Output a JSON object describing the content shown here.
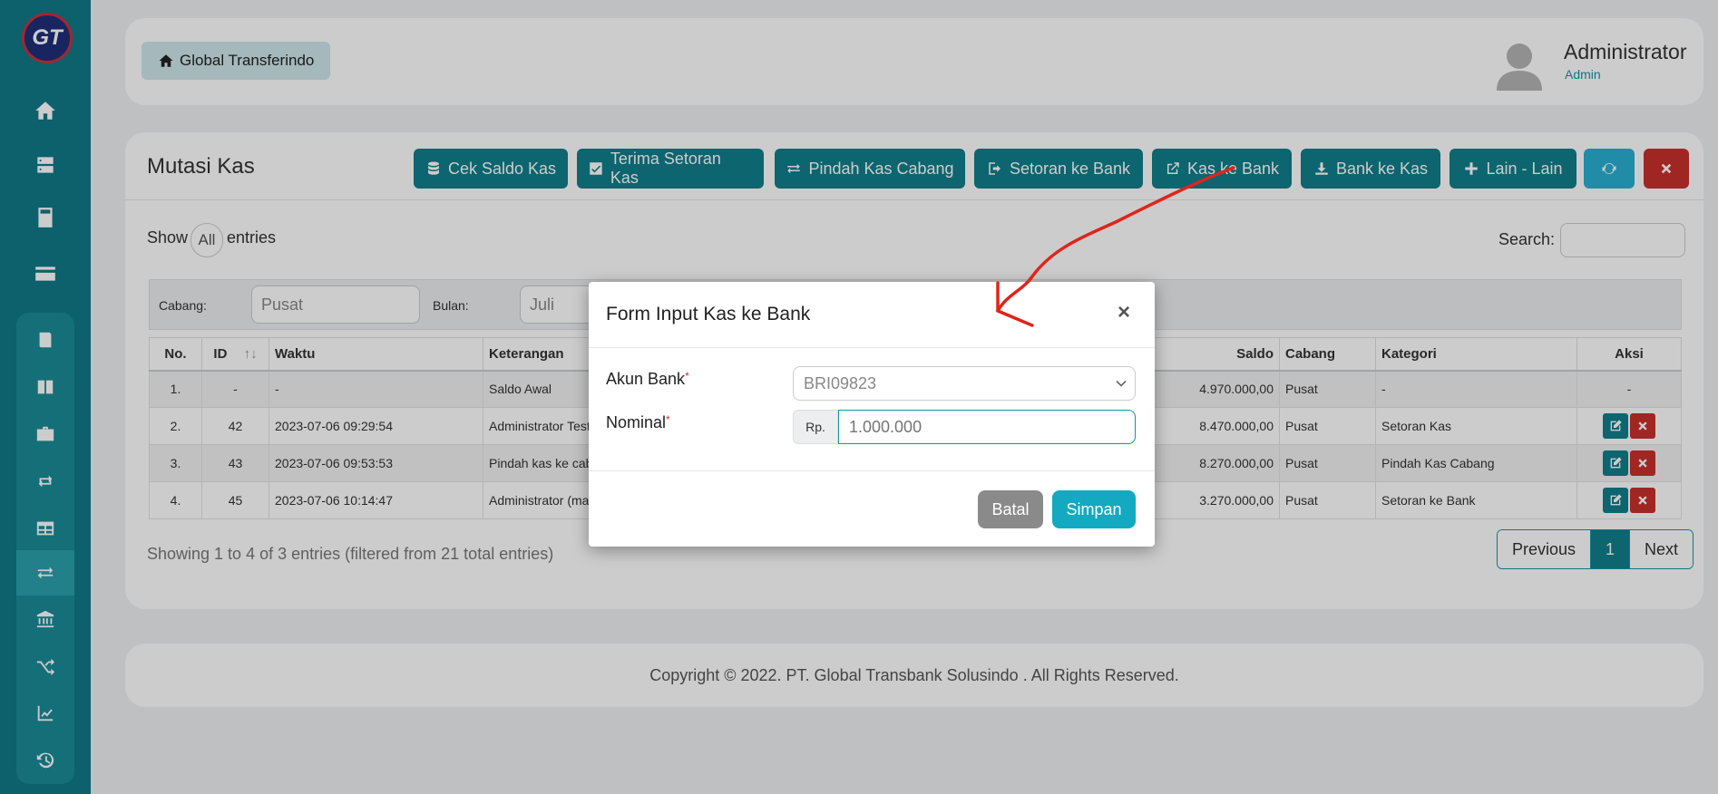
{
  "app": {
    "logo_text": "GT"
  },
  "sidebar": {
    "top_icons": [
      "home-icon",
      "server-icon",
      "calculator-icon",
      "card-icon"
    ],
    "sub_icons": [
      "book-icon",
      "columns-icon",
      "briefcase-icon",
      "retweet-icon",
      "table-icon",
      "exchange-icon",
      "bank-icon",
      "shuffle-icon",
      "chart-icon",
      "history-icon"
    ]
  },
  "header": {
    "brand": "Global Transferindo",
    "user_name": "Administrator",
    "user_role": "Admin"
  },
  "page": {
    "title": "Mutasi Kas",
    "buttons": [
      {
        "label": "Cek Saldo Kas",
        "icon": "database-icon"
      },
      {
        "label": "Terima Setoran Kas",
        "icon": "check-square-icon"
      },
      {
        "label": "Pindah Kas Cabang",
        "icon": "exchange-icon"
      },
      {
        "label": "Setoran ke Bank",
        "icon": "sign-out-icon"
      },
      {
        "label": "Kas ke Bank",
        "icon": "external-link-icon"
      },
      {
        "label": "Bank ke Kas",
        "icon": "download-icon"
      },
      {
        "label": "Lain - Lain",
        "icon": "plus-icon"
      }
    ],
    "refresh_icon": "refresh-icon",
    "close_icon": "close-icon"
  },
  "table_controls": {
    "show_label": "Show",
    "show_value": "All",
    "entries_label": "entries",
    "search_label": "Search:"
  },
  "filters": {
    "cabang_label": "Cabang:",
    "cabang_value": "Pusat",
    "bulan_label": "Bulan:",
    "bulan_value": "Juli"
  },
  "table": {
    "headers": [
      "No.",
      "ID",
      "Waktu",
      "Keterangan",
      "Saldo",
      "Cabang",
      "Kategori",
      "Aksi"
    ],
    "sort_indicator": "↑↓",
    "rows": [
      {
        "no": "1.",
        "id": "-",
        "waktu": "-",
        "keterangan": "Saldo Awal",
        "saldo": "4.970.000,00",
        "cabang": "Pusat",
        "kategori": "-",
        "aksi": "-"
      },
      {
        "no": "2.",
        "id": "42",
        "waktu": "2023-07-06 09:29:54",
        "keterangan": "Administrator Test",
        "saldo": "8.470.000,00",
        "cabang": "Pusat",
        "kategori": "Setoran Kas",
        "aksi": ""
      },
      {
        "no": "3.",
        "id": "43",
        "waktu": "2023-07-06 09:53:53",
        "keterangan": "Pindah kas ke cab",
        "saldo": "8.270.000,00",
        "cabang": "Pusat",
        "kategori": "Pindah Kas Cabang",
        "aksi": ""
      },
      {
        "no": "4.",
        "id": "45",
        "waktu": "2023-07-06 10:14:47",
        "keterangan": "Administrator (ma",
        "saldo": "3.270.000,00",
        "cabang": "Pusat",
        "kategori": "Setoran ke Bank",
        "aksi": ""
      }
    ]
  },
  "pagination": {
    "info": "Showing 1 to 4 of 3 entries (filtered from 21 total entries)",
    "previous": "Previous",
    "current": "1",
    "next": "Next"
  },
  "footer": {
    "copyright": "Copyright © 2022. PT. Global Transbank Solusindo . All Rights Reserved."
  },
  "modal": {
    "title": "Form Input Kas ke Bank",
    "close": "×",
    "akun_bank_label": "Akun Bank",
    "akun_bank_value": "BRI09823",
    "nominal_label": "Nominal",
    "required_mark": "*",
    "currency_prefix": "Rp.",
    "nominal_placeholder": "1.000.000",
    "cancel_label": "Batal",
    "save_label": "Simpan"
  },
  "colors": {
    "primary": "#0f7f8b",
    "sidebar": "#0f7a87",
    "danger": "#c9302c",
    "info": "#29b0d1",
    "annotation_arrow": "#e0241b"
  }
}
